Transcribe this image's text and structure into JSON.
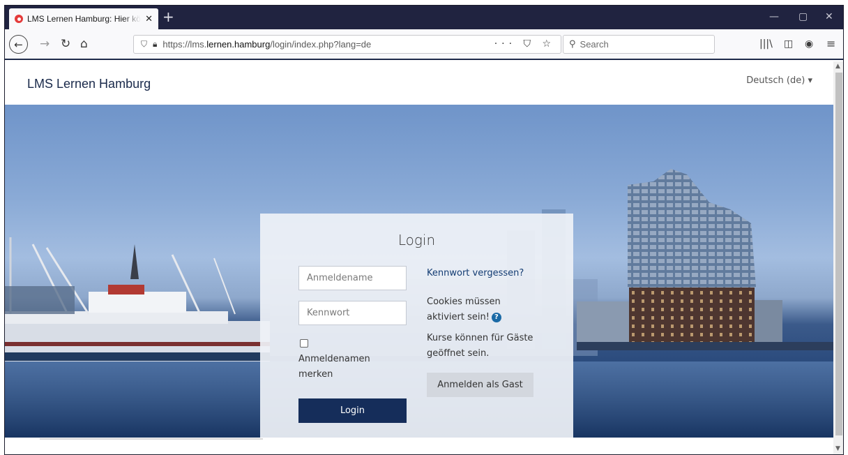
{
  "browser": {
    "tab": {
      "title": "LMS Lernen Hamburg: Hier können Sie sich anmelden",
      "close": "✕"
    },
    "new_tab": "+",
    "window_controls": {
      "minimize": "—",
      "restore": "▢",
      "close": "✕"
    },
    "url": {
      "prefix": "https://lms.",
      "host": "lernen.hamburg",
      "path": "/login/index.php?lang=de"
    },
    "url_actions": "··· ⛉ ☆",
    "search_placeholder": "Search",
    "toolbar_icons": [
      "library-icon",
      "sidebar-icon",
      "account-icon",
      "menu-icon"
    ]
  },
  "site": {
    "brand": "LMS Lernen Hamburg",
    "language": "Deutsch (de) ▾"
  },
  "login": {
    "title": "Login",
    "username_placeholder": "Anmeldename",
    "password_placeholder": "Kennwort",
    "remember_label": "Anmeldenamen merken",
    "submit_label": "Login",
    "forgot_link": "Kennwort vergessen?",
    "cookies_note": "Cookies müssen aktiviert sein!",
    "help_glyph": "?",
    "guest_note": "Kurse können für Gäste geöffnet sein.",
    "guest_button": "Anmelden als Gast"
  },
  "colors": {
    "tab_strip": "#202340",
    "brand_text": "#1a2a4b",
    "primary_button": "#152d5a",
    "link": "#133c72"
  }
}
